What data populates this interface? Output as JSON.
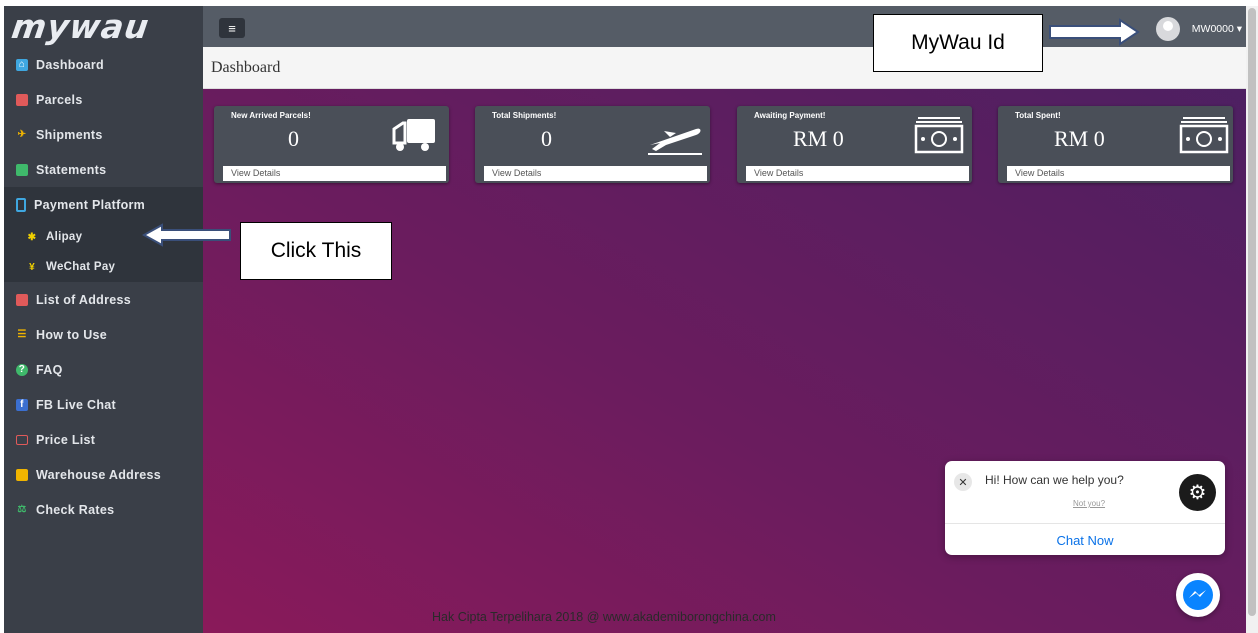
{
  "brand": {
    "logo_text": "mywau"
  },
  "sidebar": {
    "items": [
      {
        "label": "Dashboard",
        "icon": "home-icon",
        "color": "#3fa7e0"
      },
      {
        "label": "Parcels",
        "icon": "truck-icon",
        "color": "#e05a5a"
      },
      {
        "label": "Shipments",
        "icon": "plane-icon",
        "color": "#f0b400"
      },
      {
        "label": "Statements",
        "icon": "money-icon",
        "color": "#3fb96b"
      },
      {
        "label": "Payment Platform",
        "icon": "mobile-icon",
        "color": "#3fa7e0"
      },
      {
        "label": "Alipay",
        "icon": "alipay-icon",
        "color": "#f0d000"
      },
      {
        "label": "WeChat Pay",
        "icon": "yen-icon",
        "color": "#f0d000"
      },
      {
        "label": "List of Address",
        "icon": "address-book-icon",
        "color": "#e05a5a"
      },
      {
        "label": "How to Use",
        "icon": "list-icon",
        "color": "#f0b400"
      },
      {
        "label": "FAQ",
        "icon": "question-icon",
        "color": "#3fb96b"
      },
      {
        "label": "FB Live Chat",
        "icon": "facebook-icon",
        "color": "#3b6fd0"
      },
      {
        "label": "Price List",
        "icon": "tag-icon",
        "color": "#e05a5a"
      },
      {
        "label": "Warehouse Address",
        "icon": "truck-icon",
        "color": "#f0b400"
      },
      {
        "label": "Check Rates",
        "icon": "scale-icon",
        "color": "#3fb96b"
      }
    ]
  },
  "topbar": {
    "username": "MW0000 ▾"
  },
  "page": {
    "title": "Dashboard"
  },
  "cards": [
    {
      "title": "New Arrived Parcels!",
      "value": "0",
      "link": "View Details",
      "icon": "truck-icon"
    },
    {
      "title": "Total Shipments!",
      "value": "0",
      "link": "View Details",
      "icon": "plane-icon"
    },
    {
      "title": "Awaiting Payment!",
      "value": "RM 0",
      "link": "View Details",
      "icon": "money-icon"
    },
    {
      "title": "Total Spent!",
      "value": "RM 0",
      "link": "View Details",
      "icon": "money-icon"
    }
  ],
  "footer": {
    "copyright": "Hak Cipta Terpelihara 2018 @ www.akademiborongchina.com"
  },
  "chat": {
    "greeting": "Hi! How can we help you?",
    "not_you": "Not you?",
    "button": "Chat Now"
  },
  "annotations": {
    "mywau_id": "MyWau Id",
    "click_this": "Click This"
  },
  "colors": {
    "sidebar_bg": "#3a3f48",
    "topbar_bg": "#555c66",
    "card_bg": "#4a4f58",
    "chat_link": "#0a72e8"
  }
}
